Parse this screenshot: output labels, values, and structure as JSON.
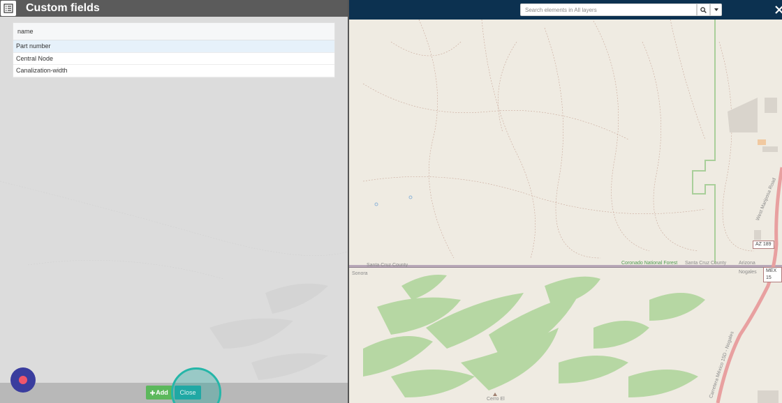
{
  "panel": {
    "title": "Custom fields",
    "icon": "list-icon",
    "table": {
      "header": "name",
      "rows": [
        "Part number",
        "Central Node",
        "Canalization-width"
      ],
      "selected_index": 0
    },
    "buttons": {
      "add_label": "Add",
      "add_icon": "plus-icon",
      "close_label": "Close"
    },
    "colors": {
      "add": "#5cb85c",
      "close": "#20a8a4",
      "header": "#5b5b5b"
    }
  },
  "topbar": {
    "search_placeholder": "Search elements in All layers",
    "search_icon": "search-icon",
    "dropdown_icon": "caret-down-icon",
    "close_icon": "close-icon",
    "background": "#0c3150"
  },
  "map": {
    "labels": {
      "santa_cruz_left": "Santa Cruz County",
      "sonora": "Sonora",
      "coronado": "Coronado National Forest",
      "santa_cruz_right": "Santa Cruz County",
      "arizona": "Arizona",
      "nogales": "Nogales",
      "cerro": "Cerro El",
      "az189": "AZ 189",
      "mex15": "MEX 15",
      "road1": "West Mariposa Road",
      "road2": "Carretera México 15D - Nogales"
    }
  },
  "fab": {
    "icon": "record-icon",
    "color": "#3a3d9e"
  }
}
